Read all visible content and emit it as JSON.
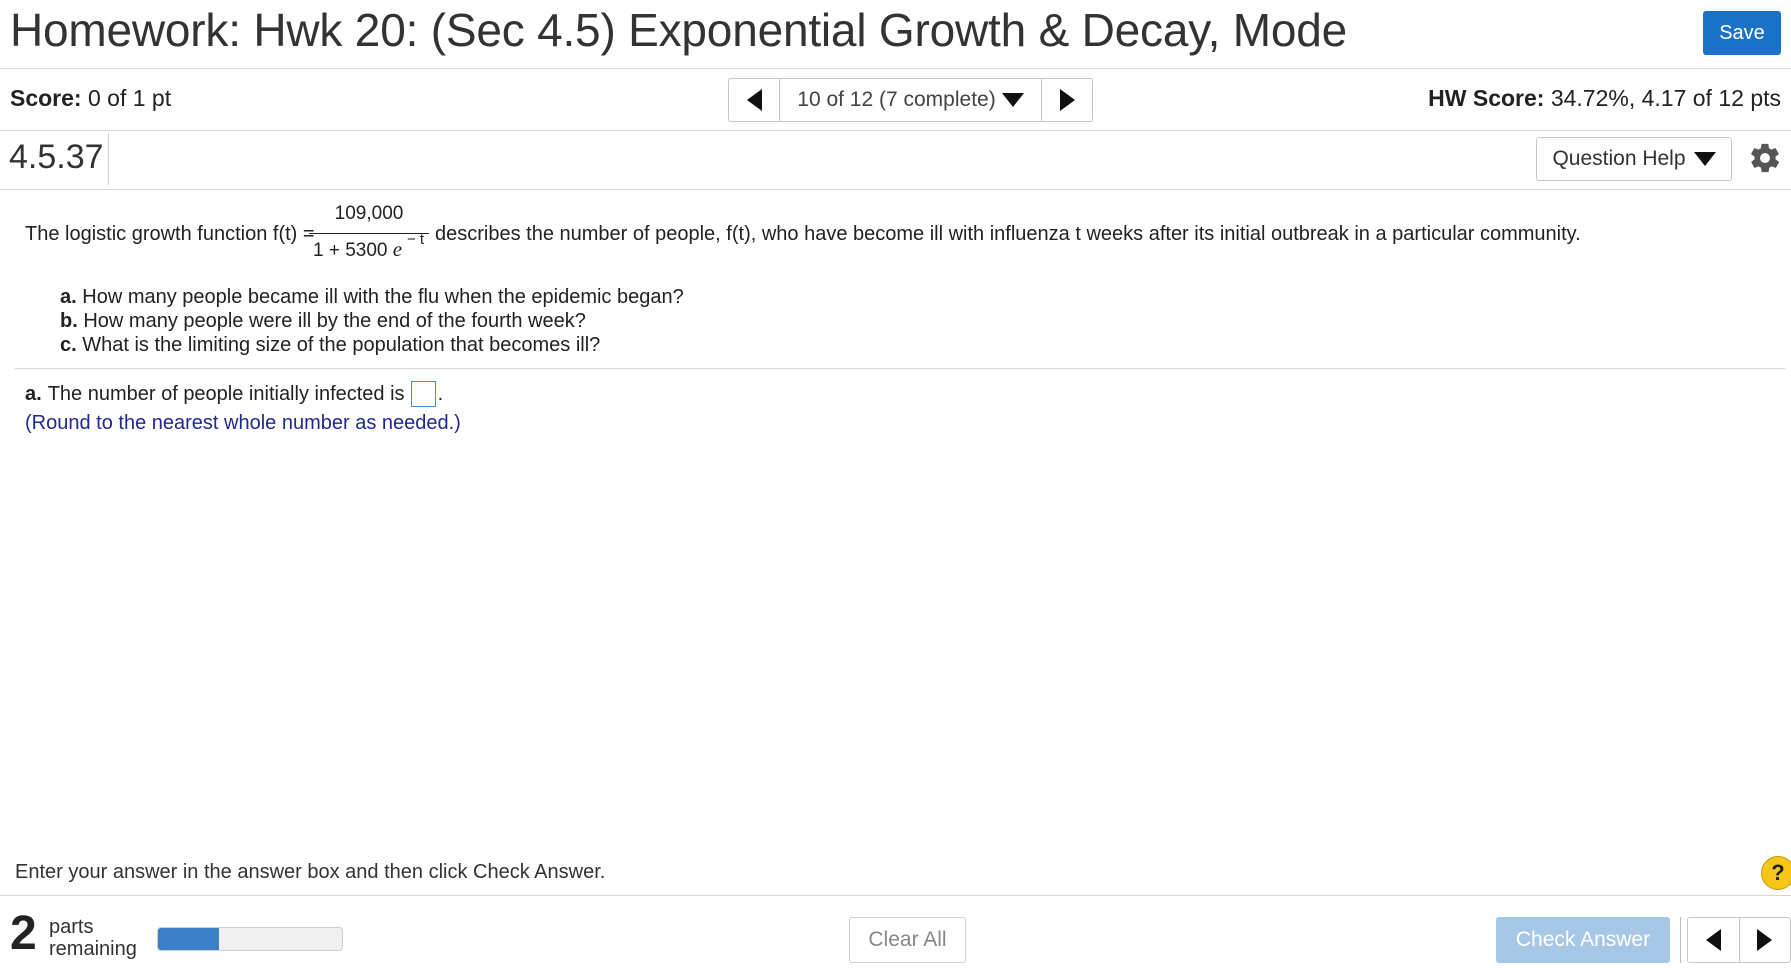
{
  "header": {
    "title": "Homework: Hwk 20: (Sec 4.5) Exponential Growth & Decay, Mode",
    "save_label": "Save"
  },
  "score": {
    "label": "Score:",
    "value": "0 of 1 pt"
  },
  "navigator": {
    "position_text": "10 of 12 (7 complete)"
  },
  "hw_score": {
    "label": "HW Score:",
    "value": "34.72%, 4.17 of 12 pts"
  },
  "question": {
    "id": "4.5.37",
    "help_label": "Question Help",
    "intro": "The logistic growth function f(t) =",
    "fraction": {
      "numerator": "109,000",
      "denominator_base": "1 + 5300",
      "denominator_e": "e",
      "exponent": "− t"
    },
    "intro_rest": "describes the number of people, f(t), who have become ill with influenza t weeks after its initial outbreak in a particular community.",
    "parts": [
      {
        "label": "a.",
        "text": "How many people became ill with the flu when the epidemic began?"
      },
      {
        "label": "b.",
        "text": "How many people were ill by the end of the fourth week?"
      },
      {
        "label": "c.",
        "text": "What is the limiting size of the population that becomes ill?"
      }
    ],
    "answer": {
      "label": "a.",
      "prompt": "The number of people initially infected is",
      "suffix": ".",
      "value": "",
      "note": "(Round to the nearest whole number as needed.)"
    }
  },
  "instructions": "Enter your answer in the answer box and then click Check Answer.",
  "help_symbol": "?",
  "footer": {
    "parts_count": "2",
    "parts_line1": "parts",
    "parts_line2": "remaining",
    "progress_fraction": 0.33,
    "clear_label": "Clear All",
    "check_label": "Check Answer"
  },
  "colors": {
    "accent": "#1a73c8",
    "check_disabled": "#a6c8e6",
    "note_blue": "#1f2a8c",
    "progress_fill": "#3c7ec8",
    "help_yellow": "#f5c518"
  },
  "icons": [
    "chevron-left-icon",
    "chevron-right-icon",
    "caret-down-icon",
    "gear-icon",
    "question-icon"
  ]
}
